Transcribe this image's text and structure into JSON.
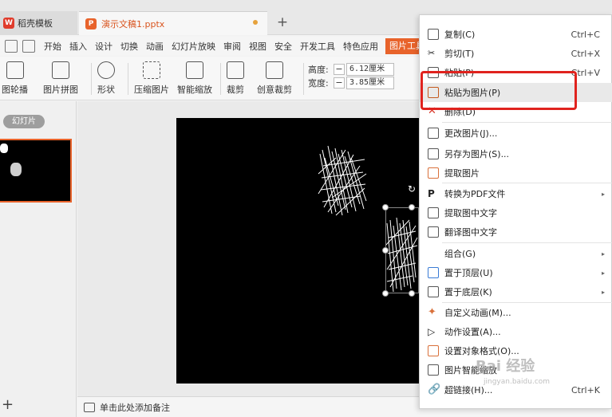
{
  "tabs": {
    "home": "稻壳模板",
    "doc": "演示文稿1.pptx",
    "new_tab": "+"
  },
  "menu": [
    "开始",
    "插入",
    "设计",
    "切换",
    "动画",
    "幻灯片放映",
    "审阅",
    "视图",
    "安全",
    "开发工具",
    "特色应用"
  ],
  "menu_active": "图片工具",
  "ribbon": {
    "tools": [
      "图轮播",
      "图片拼图",
      "形状",
      "压缩图片",
      "智能缩放",
      "裁剪",
      "创意裁剪"
    ],
    "height_label": "高度:",
    "height_value": "6.12厘米",
    "width_label": "宽度:",
    "width_value": "3.85厘米",
    "minus": "−"
  },
  "leftpanel": {
    "slides_tab": "幻灯片",
    "add": "+"
  },
  "notes": {
    "placeholder": "单击此处添加备注"
  },
  "context_menu": [
    {
      "label": "复制(C)",
      "shortcut": "Ctrl+C",
      "icon": "copy-icon"
    },
    {
      "label": "剪切(T)",
      "shortcut": "Ctrl+X",
      "icon": "scissors-icon"
    },
    {
      "label": "粘贴(P)",
      "shortcut": "Ctrl+V",
      "icon": "paste-icon"
    },
    {
      "label": "粘贴为图片(P)",
      "shortcut": "",
      "icon": "paste-image-icon",
      "highlighted": true
    },
    {
      "label": "删除(D)",
      "shortcut": "",
      "icon": "delete-icon"
    },
    {
      "label": "更改图片(J)...",
      "shortcut": "",
      "icon": "change-image-icon"
    },
    {
      "label": "另存为图片(S)...",
      "shortcut": "",
      "icon": "save-image-icon"
    },
    {
      "label": "提取图片",
      "shortcut": "",
      "icon": "extract-image-icon"
    },
    {
      "label": "转换为PDF文件",
      "shortcut": "",
      "icon": "pdf-icon",
      "submenu": true
    },
    {
      "label": "提取图中文字",
      "shortcut": "",
      "icon": "ocr-icon"
    },
    {
      "label": "翻译图中文字",
      "shortcut": "",
      "icon": "translate-icon"
    },
    {
      "label": "组合(G)",
      "shortcut": "",
      "icon": "",
      "submenu": true
    },
    {
      "label": "置于顶层(U)",
      "shortcut": "",
      "icon": "bring-front-icon",
      "submenu": true
    },
    {
      "label": "置于底层(K)",
      "shortcut": "",
      "icon": "send-back-icon",
      "submenu": true
    },
    {
      "label": "自定义动画(M)...",
      "shortcut": "",
      "icon": "animation-icon"
    },
    {
      "label": "动作设置(A)...",
      "shortcut": "",
      "icon": "action-icon"
    },
    {
      "label": "设置对象格式(O)...",
      "shortcut": "",
      "icon": "format-icon"
    },
    {
      "label": "图片智能缩放",
      "shortcut": "",
      "icon": "smart-scale-icon"
    },
    {
      "label": "超链接(H)...",
      "shortcut": "Ctrl+K",
      "icon": "link-icon"
    }
  ],
  "watermark": {
    "text": "Bai 经验",
    "url": "jingyan.baidu.com"
  },
  "colors": {
    "accent": "#e8632b",
    "highlight_box": "#e0231e"
  }
}
